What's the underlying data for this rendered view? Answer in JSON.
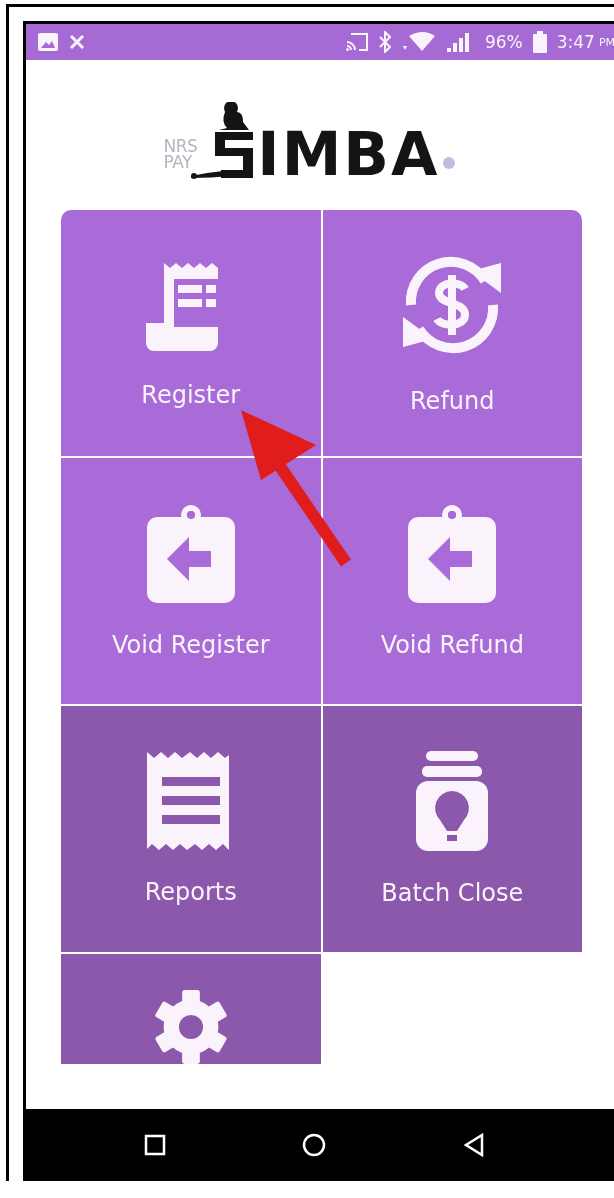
{
  "status_bar": {
    "battery": "96%",
    "time": "3:47",
    "time_suffix": "PM"
  },
  "logo": {
    "top_line": "NRS",
    "bottom_line": "PAY",
    "wordmark": "IMBA"
  },
  "tiles": [
    {
      "label": "Register",
      "kind": "receipt",
      "color": "#a96bd8"
    },
    {
      "label": "Refund",
      "kind": "refund",
      "color": "#a96bd8"
    },
    {
      "label": "Void Register",
      "kind": "clipboard",
      "color": "#a96bd8"
    },
    {
      "label": "Void Refund",
      "kind": "clipboard",
      "color": "#a96bd8"
    },
    {
      "label": "Reports",
      "kind": "report",
      "color": "#8b58ab"
    },
    {
      "label": "Batch Close",
      "kind": "jar",
      "color": "#8b58ab"
    },
    {
      "kind": "gear",
      "color": "#8b58ab"
    }
  ]
}
